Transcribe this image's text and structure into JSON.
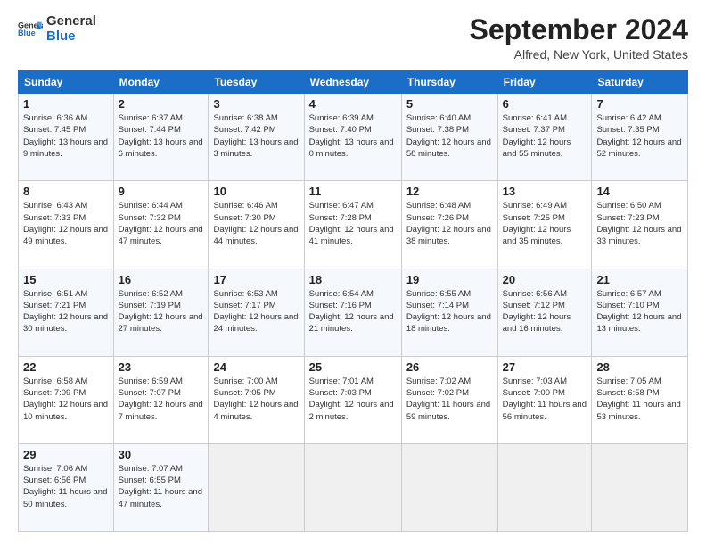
{
  "header": {
    "logo_general": "General",
    "logo_blue": "Blue",
    "month_title": "September 2024",
    "location": "Alfred, New York, United States"
  },
  "weekdays": [
    "Sunday",
    "Monday",
    "Tuesday",
    "Wednesday",
    "Thursday",
    "Friday",
    "Saturday"
  ],
  "weeks": [
    [
      {
        "day": "1",
        "sunrise": "6:36 AM",
        "sunset": "7:45 PM",
        "daylight": "13 hours and 9 minutes."
      },
      {
        "day": "2",
        "sunrise": "6:37 AM",
        "sunset": "7:44 PM",
        "daylight": "13 hours and 6 minutes."
      },
      {
        "day": "3",
        "sunrise": "6:38 AM",
        "sunset": "7:42 PM",
        "daylight": "13 hours and 3 minutes."
      },
      {
        "day": "4",
        "sunrise": "6:39 AM",
        "sunset": "7:40 PM",
        "daylight": "13 hours and 0 minutes."
      },
      {
        "day": "5",
        "sunrise": "6:40 AM",
        "sunset": "7:38 PM",
        "daylight": "12 hours and 58 minutes."
      },
      {
        "day": "6",
        "sunrise": "6:41 AM",
        "sunset": "7:37 PM",
        "daylight": "12 hours and 55 minutes."
      },
      {
        "day": "7",
        "sunrise": "6:42 AM",
        "sunset": "7:35 PM",
        "daylight": "12 hours and 52 minutes."
      }
    ],
    [
      {
        "day": "8",
        "sunrise": "6:43 AM",
        "sunset": "7:33 PM",
        "daylight": "12 hours and 49 minutes."
      },
      {
        "day": "9",
        "sunrise": "6:44 AM",
        "sunset": "7:32 PM",
        "daylight": "12 hours and 47 minutes."
      },
      {
        "day": "10",
        "sunrise": "6:46 AM",
        "sunset": "7:30 PM",
        "daylight": "12 hours and 44 minutes."
      },
      {
        "day": "11",
        "sunrise": "6:47 AM",
        "sunset": "7:28 PM",
        "daylight": "12 hours and 41 minutes."
      },
      {
        "day": "12",
        "sunrise": "6:48 AM",
        "sunset": "7:26 PM",
        "daylight": "12 hours and 38 minutes."
      },
      {
        "day": "13",
        "sunrise": "6:49 AM",
        "sunset": "7:25 PM",
        "daylight": "12 hours and 35 minutes."
      },
      {
        "day": "14",
        "sunrise": "6:50 AM",
        "sunset": "7:23 PM",
        "daylight": "12 hours and 33 minutes."
      }
    ],
    [
      {
        "day": "15",
        "sunrise": "6:51 AM",
        "sunset": "7:21 PM",
        "daylight": "12 hours and 30 minutes."
      },
      {
        "day": "16",
        "sunrise": "6:52 AM",
        "sunset": "7:19 PM",
        "daylight": "12 hours and 27 minutes."
      },
      {
        "day": "17",
        "sunrise": "6:53 AM",
        "sunset": "7:17 PM",
        "daylight": "12 hours and 24 minutes."
      },
      {
        "day": "18",
        "sunrise": "6:54 AM",
        "sunset": "7:16 PM",
        "daylight": "12 hours and 21 minutes."
      },
      {
        "day": "19",
        "sunrise": "6:55 AM",
        "sunset": "7:14 PM",
        "daylight": "12 hours and 18 minutes."
      },
      {
        "day": "20",
        "sunrise": "6:56 AM",
        "sunset": "7:12 PM",
        "daylight": "12 hours and 16 minutes."
      },
      {
        "day": "21",
        "sunrise": "6:57 AM",
        "sunset": "7:10 PM",
        "daylight": "12 hours and 13 minutes."
      }
    ],
    [
      {
        "day": "22",
        "sunrise": "6:58 AM",
        "sunset": "7:09 PM",
        "daylight": "12 hours and 10 minutes."
      },
      {
        "day": "23",
        "sunrise": "6:59 AM",
        "sunset": "7:07 PM",
        "daylight": "12 hours and 7 minutes."
      },
      {
        "day": "24",
        "sunrise": "7:00 AM",
        "sunset": "7:05 PM",
        "daylight": "12 hours and 4 minutes."
      },
      {
        "day": "25",
        "sunrise": "7:01 AM",
        "sunset": "7:03 PM",
        "daylight": "12 hours and 2 minutes."
      },
      {
        "day": "26",
        "sunrise": "7:02 AM",
        "sunset": "7:02 PM",
        "daylight": "11 hours and 59 minutes."
      },
      {
        "day": "27",
        "sunrise": "7:03 AM",
        "sunset": "7:00 PM",
        "daylight": "11 hours and 56 minutes."
      },
      {
        "day": "28",
        "sunrise": "7:05 AM",
        "sunset": "6:58 PM",
        "daylight": "11 hours and 53 minutes."
      }
    ],
    [
      {
        "day": "29",
        "sunrise": "7:06 AM",
        "sunset": "6:56 PM",
        "daylight": "11 hours and 50 minutes."
      },
      {
        "day": "30",
        "sunrise": "7:07 AM",
        "sunset": "6:55 PM",
        "daylight": "11 hours and 47 minutes."
      },
      null,
      null,
      null,
      null,
      null
    ]
  ],
  "labels": {
    "sunrise": "Sunrise:",
    "sunset": "Sunset:",
    "daylight": "Daylight:"
  }
}
